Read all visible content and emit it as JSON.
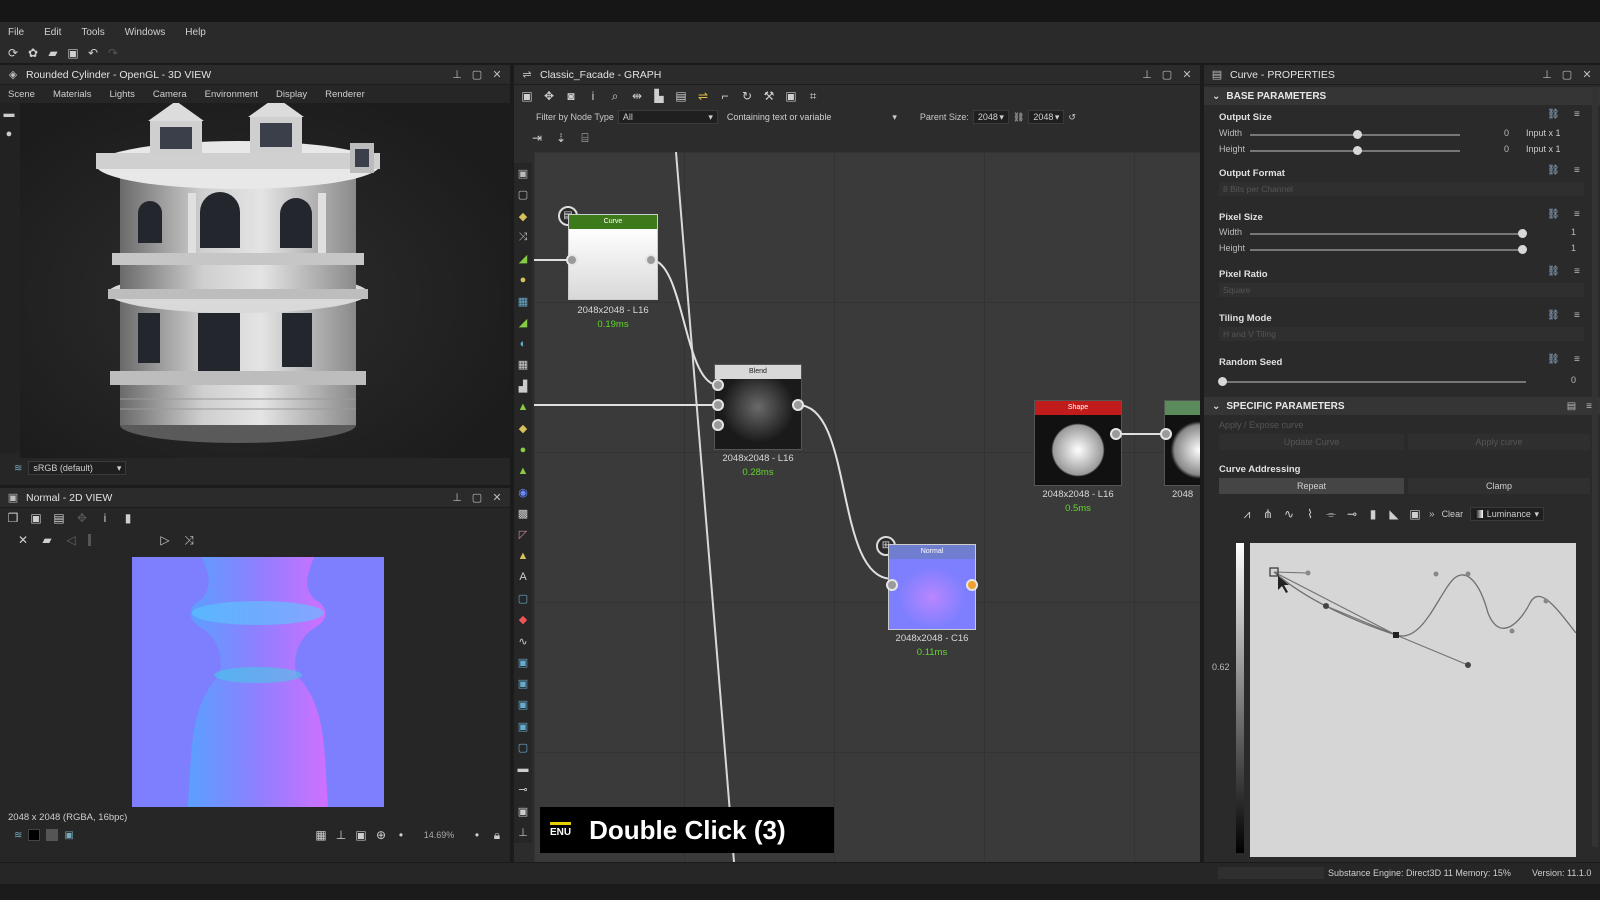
{
  "menu": [
    "File",
    "Edit",
    "Tools",
    "Windows",
    "Help"
  ],
  "view3d": {
    "title": "Rounded Cylinder - OpenGL - 3D VIEW",
    "submenu": [
      "Scene",
      "Materials",
      "Lights",
      "Camera",
      "Environment",
      "Display",
      "Renderer"
    ],
    "colorspace": "sRGB (default)"
  },
  "view2d": {
    "title": "Normal - 2D VIEW",
    "info": "2048 x 2048 (RGBA, 16bpc)",
    "zoom": "14.69%"
  },
  "graph": {
    "title": "Classic_Facade - GRAPH",
    "filter_label": "Filter by Node Type",
    "filter_value": "All",
    "search_placeholder": "Containing text or variable",
    "parent_size_label": "Parent Size:",
    "parent_w": "2048",
    "parent_h": "2048",
    "nodes": {
      "curve": {
        "title": "Curve",
        "res": "2048x2048 - L16",
        "time": "0.19ms"
      },
      "blend": {
        "title": "Blend",
        "res": "2048x2048 - L16",
        "time": "0.28ms"
      },
      "normal": {
        "title": "Normal",
        "res": "2048x2048 - C16",
        "time": "0.11ms"
      },
      "shape": {
        "title": "Shape",
        "res": "2048x2048 - L16",
        "time": "0.5ms"
      },
      "partial": {
        "res": "2048"
      }
    },
    "overlay_lang": "ENU",
    "overlay_text": "Double Click (3)"
  },
  "props": {
    "title": "Curve - PROPERTIES",
    "base_section": "BASE PARAMETERS",
    "output_size": "Output Size",
    "width": "Width",
    "height": "Height",
    "out_w_val": "0",
    "out_h_val": "0",
    "out_w_mode": "Input x 1",
    "out_h_mode": "Input x 1",
    "output_format": "Output Format",
    "output_format_val": "8 Bits per Channel",
    "pixel_size": "Pixel Size",
    "px_w_val": "1",
    "px_h_val": "1",
    "pixel_ratio": "Pixel Ratio",
    "pixel_ratio_val": "Square",
    "tiling_mode": "Tiling Mode",
    "tiling_mode_val": "H and V Tiling",
    "random_seed": "Random Seed",
    "random_seed_val": "0",
    "specific_section": "SPECIFIC PARAMETERS",
    "apply_expose": "Apply / Expose curve",
    "update_curve": "Update Curve",
    "apply_curve": "Apply curve",
    "curve_addressing": "Curve Addressing",
    "repeat": "Repeat",
    "clamp": "Clamp",
    "clear": "Clear",
    "channel": "Luminance",
    "curve_value": "0.62"
  },
  "status": {
    "engine": "Substance Engine: Direct3D 11 Memory: 15%",
    "version": "Version: 11.1.0"
  }
}
